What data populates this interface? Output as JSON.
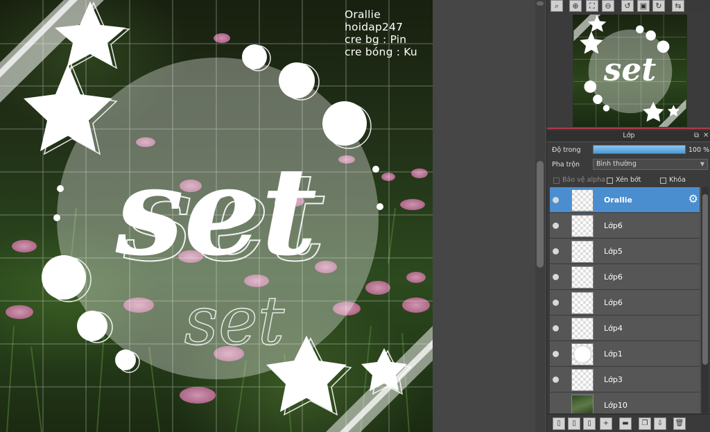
{
  "canvas": {
    "credits": [
      "Orallie",
      "hoidap247",
      "cre bg : Pin",
      "cre bóng : Ku"
    ],
    "main_text": "set",
    "shadow_text": "set"
  },
  "toolbar": {
    "buttons": [
      {
        "name": "zoom-search-icon",
        "glyph": "⌕"
      },
      {
        "name": "zoom-in-icon",
        "glyph": "⊕"
      },
      {
        "name": "fit-icon",
        "glyph": "⛶"
      },
      {
        "name": "zoom-out-icon",
        "glyph": "⊖"
      },
      {
        "name": "rotate-left-icon",
        "glyph": "↺"
      },
      {
        "name": "reset-view-icon",
        "glyph": "▣"
      },
      {
        "name": "rotate-right-icon",
        "glyph": "↻"
      },
      {
        "name": "flip-icon",
        "glyph": "⇆"
      }
    ]
  },
  "layers_panel": {
    "title": "Lớp",
    "opacity_label": "Độ trong",
    "opacity_value": "100 %",
    "opacity_level": 1.0,
    "blend_label": "Pha trộn",
    "blend_value": "Bình thường",
    "protect_alpha_label": "Bảo vệ alpha",
    "clipping_label": "Xén bớt",
    "lock_label": "Khóa",
    "layers": [
      {
        "name": "Orallie",
        "selected": true,
        "thumb": "checker"
      },
      {
        "name": "Lớp6",
        "selected": false,
        "thumb": "checker"
      },
      {
        "name": "Lớp5",
        "selected": false,
        "thumb": "checker"
      },
      {
        "name": "Lớp6",
        "selected": false,
        "thumb": "checker"
      },
      {
        "name": "Lớp6",
        "selected": false,
        "thumb": "checker"
      },
      {
        "name": "Lớp4",
        "selected": false,
        "thumb": "checker"
      },
      {
        "name": "Lớp1",
        "selected": false,
        "thumb": "circle"
      },
      {
        "name": "Lớp3",
        "selected": false,
        "thumb": "checker"
      },
      {
        "name": "Lớp10",
        "selected": false,
        "thumb": "photo"
      }
    ]
  },
  "layer_toolbar": {
    "buttons": [
      {
        "name": "new-layer-icon",
        "glyph": "▯"
      },
      {
        "name": "new-layer-8bit-icon",
        "glyph": "▯"
      },
      {
        "name": "new-layer-1bit-icon",
        "glyph": "▯"
      },
      {
        "name": "add-layer-menu-icon",
        "glyph": "+"
      },
      {
        "name": "new-folder-icon",
        "glyph": "▬"
      },
      {
        "name": "duplicate-layer-icon",
        "glyph": "❐"
      },
      {
        "name": "merge-layer-icon",
        "glyph": "⇩"
      },
      {
        "name": "delete-layer-icon",
        "glyph": "🗑"
      }
    ]
  }
}
